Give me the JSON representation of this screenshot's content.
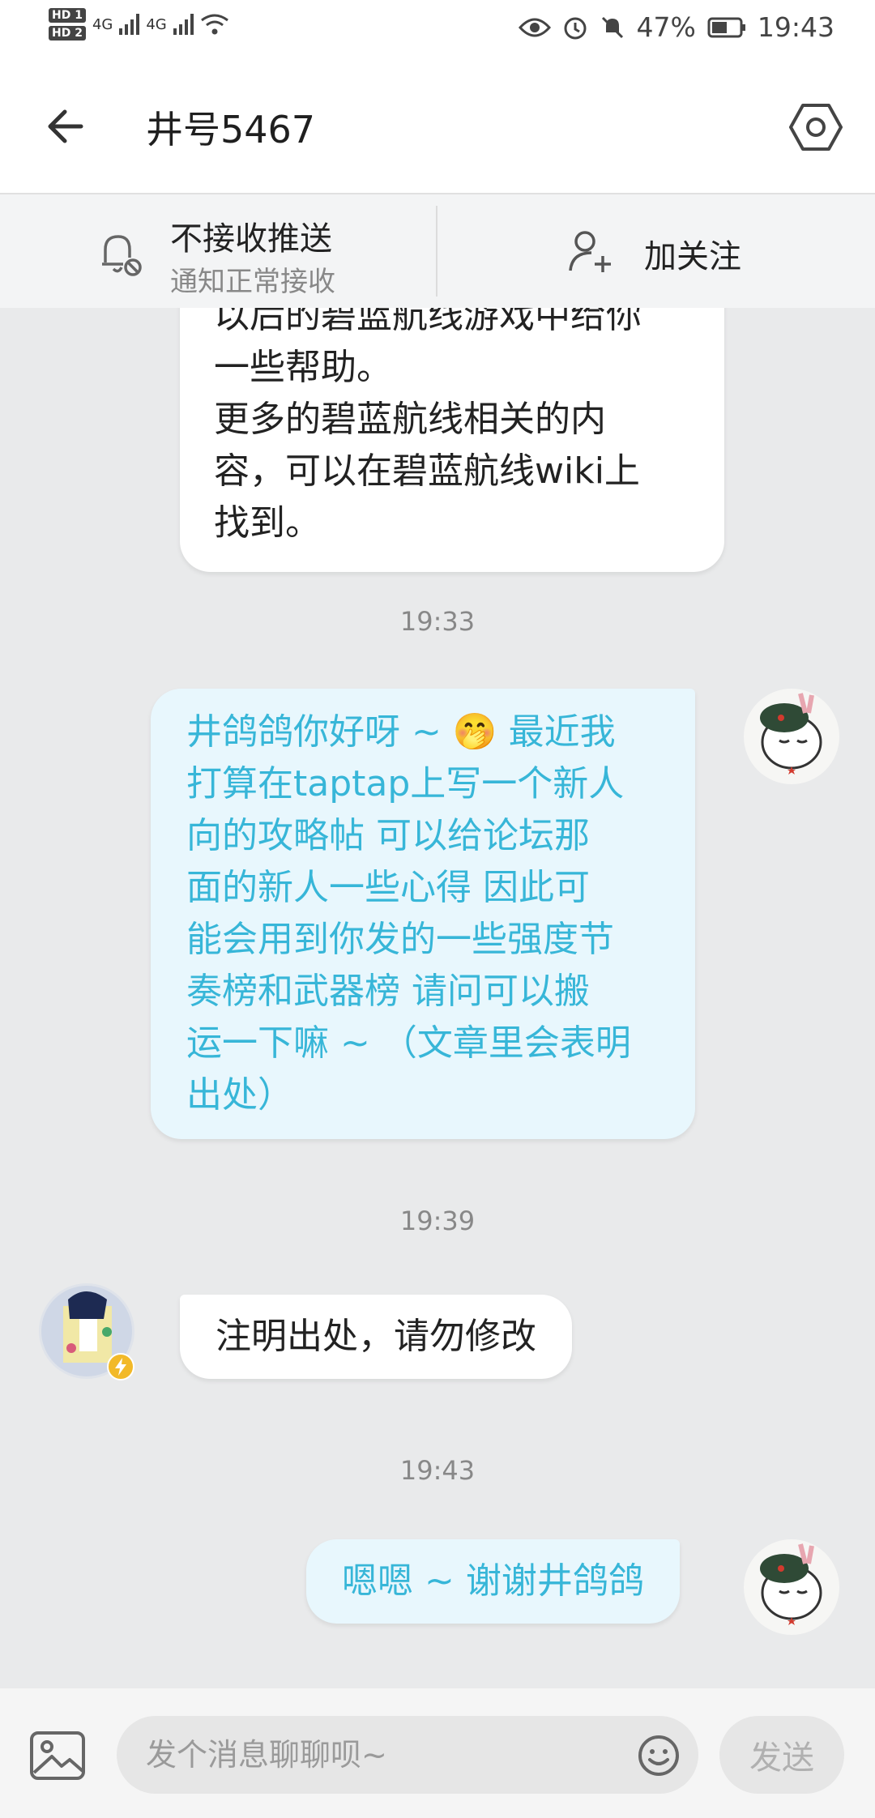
{
  "status_bar": {
    "sim1": "HD 1",
    "sim2": "HD 2",
    "net1": "4G",
    "net2": "4G",
    "battery": "47%",
    "time": "19:43"
  },
  "header": {
    "title": "井号5467"
  },
  "push": {
    "title": "不接收推送",
    "subtitle": "通知正常接收",
    "follow_label": "加关注"
  },
  "messages": [
    {
      "side": "incoming",
      "lines": [
        "以后的碧蓝航线游戏中给你",
        "一些帮助。",
        "更多的碧蓝航线相关的内",
        "容，可以在碧蓝航线wiki上",
        "找到。"
      ]
    },
    {
      "time": "19:33"
    },
    {
      "side": "outgoing",
      "lines": [
        "井鸽鸽你好呀 ~ 🤭  最近我",
        "打算在taptap上写一个新人",
        "向的攻略帖   可以给论坛那",
        "面的新人一些心得  因此可",
        "能会用到你发的一些强度节",
        "奏榜和武器榜   请问可以搬",
        "运一下嘛 ~ （文章里会表明",
        "出处）"
      ]
    },
    {
      "time": "19:39"
    },
    {
      "side": "incoming",
      "text": "注明出处，请勿修改"
    },
    {
      "time": "19:43"
    },
    {
      "side": "outgoing",
      "text": "嗯嗯 ~  谢谢井鸽鸽"
    }
  ],
  "input": {
    "placeholder": "发个消息聊聊呗~",
    "send_label": "发送"
  },
  "colors": {
    "accent": "#37b6d8",
    "outgoing_bubble": "#e8f7fd",
    "background": "#e9eaeb"
  }
}
